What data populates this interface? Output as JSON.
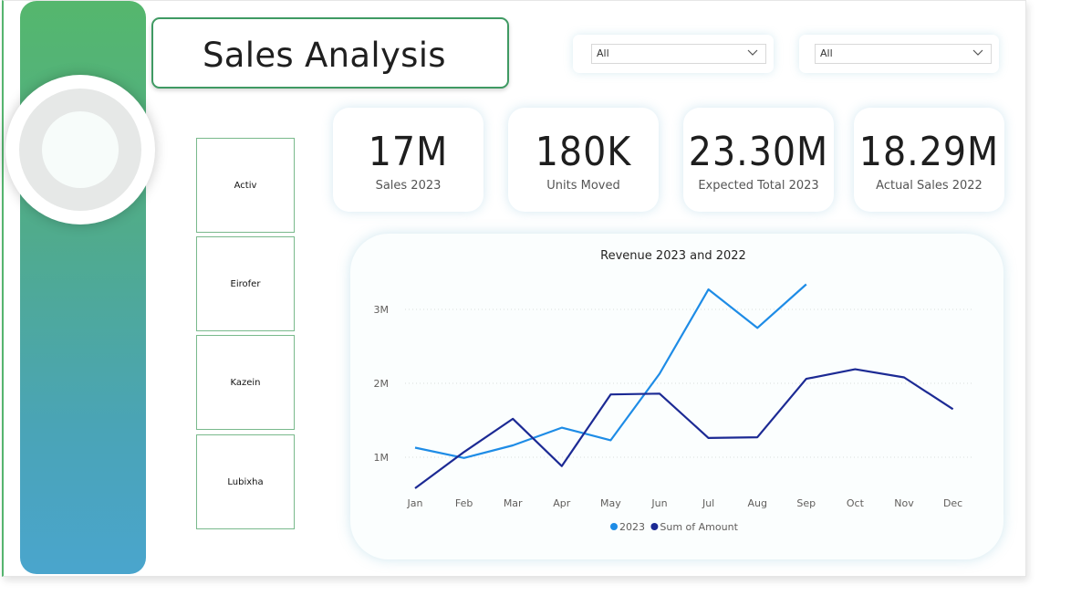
{
  "header": {
    "title": "Sales Analysis"
  },
  "filters": [
    {
      "selected": "All"
    },
    {
      "selected": "All"
    }
  ],
  "products": [
    "Activ",
    "Eirofer",
    "Kazein",
    "Lubixha"
  ],
  "kpis": [
    {
      "value": "17M",
      "label": "Sales 2023"
    },
    {
      "value": "180K",
      "label": "Units Moved"
    },
    {
      "value": "23.30M",
      "label": "Expected Total 2023"
    },
    {
      "value": "18.29M",
      "label": "Actual Sales 2022"
    }
  ],
  "colors": {
    "sidebar_top": "#55b76d",
    "sidebar_bottom": "#4aa5cd",
    "series_2023": "#1e8ce6",
    "series_amount": "#1c2a94"
  },
  "chart_data": {
    "type": "line",
    "title": "Revenue 2023 and 2022",
    "categories": [
      "Jan",
      "Feb",
      "Mar",
      "Apr",
      "May",
      "Jun",
      "Jul",
      "Aug",
      "Sep",
      "Oct",
      "Nov",
      "Dec"
    ],
    "y_ticks": [
      "1M",
      "2M",
      "3M"
    ],
    "y_tick_values": [
      1000000,
      2000000,
      3000000
    ],
    "ylim": [
      600000,
      3400000
    ],
    "grid": true,
    "legend_position": "bottom",
    "series": [
      {
        "name": "2023",
        "color": "#1e8ce6",
        "values": [
          1130000,
          990000,
          1160000,
          1400000,
          1230000,
          2130000,
          3270000,
          2750000,
          3340000,
          null,
          null,
          null
        ]
      },
      {
        "name": "Sum of Amount",
        "color": "#1c2a94",
        "values": [
          580000,
          1070000,
          1520000,
          880000,
          1850000,
          1860000,
          1260000,
          1270000,
          2060000,
          2190000,
          2080000,
          1650000
        ]
      }
    ]
  }
}
